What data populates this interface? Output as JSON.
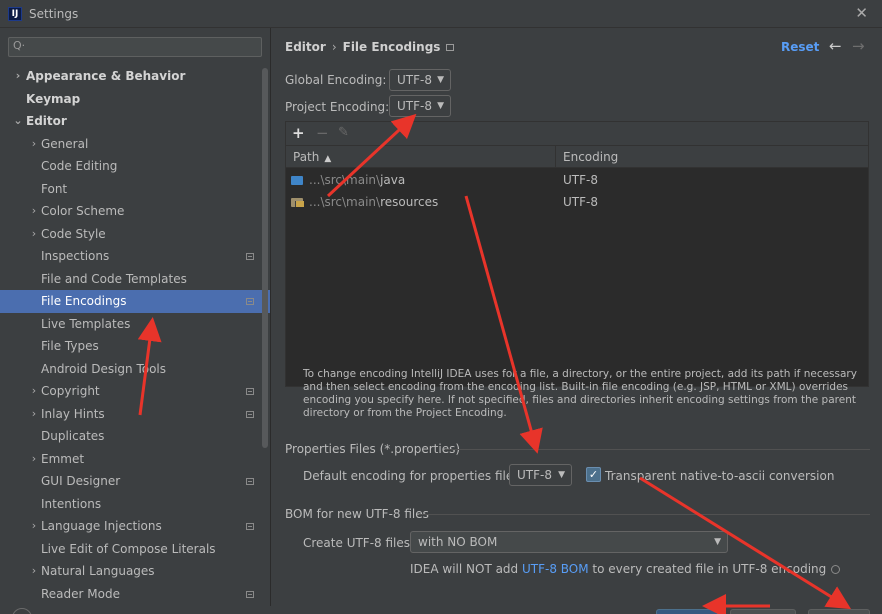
{
  "window": {
    "title": "Settings",
    "app_icon": "intellij-logo-icon",
    "app_icon_text": "IJ",
    "close_glyph": "✕"
  },
  "search": {
    "placeholder": "",
    "icon": "search-icon",
    "glyph": "Q·"
  },
  "sidebar": {
    "items": [
      {
        "label": "Appearance & Behavior",
        "level": 0,
        "expander": "›",
        "bold": true,
        "project_icon": false,
        "selected": false
      },
      {
        "label": "Keymap",
        "level": 0,
        "expander": "",
        "bold": true,
        "project_icon": false,
        "selected": false
      },
      {
        "label": "Editor",
        "level": 0,
        "expander": "⌄",
        "bold": true,
        "project_icon": false,
        "selected": false
      },
      {
        "label": "General",
        "level": 1,
        "expander": "›",
        "bold": false,
        "project_icon": false,
        "selected": false
      },
      {
        "label": "Code Editing",
        "level": 1,
        "expander": "",
        "bold": false,
        "project_icon": false,
        "selected": false
      },
      {
        "label": "Font",
        "level": 1,
        "expander": "",
        "bold": false,
        "project_icon": false,
        "selected": false
      },
      {
        "label": "Color Scheme",
        "level": 1,
        "expander": "›",
        "bold": false,
        "project_icon": false,
        "selected": false
      },
      {
        "label": "Code Style",
        "level": 1,
        "expander": "›",
        "bold": false,
        "project_icon": false,
        "selected": false
      },
      {
        "label": "Inspections",
        "level": 1,
        "expander": "",
        "bold": false,
        "project_icon": true,
        "selected": false
      },
      {
        "label": "File and Code Templates",
        "level": 1,
        "expander": "",
        "bold": false,
        "project_icon": false,
        "selected": false
      },
      {
        "label": "File Encodings",
        "level": 1,
        "expander": "",
        "bold": false,
        "project_icon": true,
        "selected": true
      },
      {
        "label": "Live Templates",
        "level": 1,
        "expander": "",
        "bold": false,
        "project_icon": false,
        "selected": false
      },
      {
        "label": "File Types",
        "level": 1,
        "expander": "",
        "bold": false,
        "project_icon": false,
        "selected": false
      },
      {
        "label": "Android Design Tools",
        "level": 1,
        "expander": "",
        "bold": false,
        "project_icon": false,
        "selected": false
      },
      {
        "label": "Copyright",
        "level": 1,
        "expander": "›",
        "bold": false,
        "project_icon": true,
        "selected": false
      },
      {
        "label": "Inlay Hints",
        "level": 1,
        "expander": "›",
        "bold": false,
        "project_icon": true,
        "selected": false
      },
      {
        "label": "Duplicates",
        "level": 1,
        "expander": "",
        "bold": false,
        "project_icon": false,
        "selected": false
      },
      {
        "label": "Emmet",
        "level": 1,
        "expander": "›",
        "bold": false,
        "project_icon": false,
        "selected": false
      },
      {
        "label": "GUI Designer",
        "level": 1,
        "expander": "",
        "bold": false,
        "project_icon": true,
        "selected": false
      },
      {
        "label": "Intentions",
        "level": 1,
        "expander": "",
        "bold": false,
        "project_icon": false,
        "selected": false
      },
      {
        "label": "Language Injections",
        "level": 1,
        "expander": "›",
        "bold": false,
        "project_icon": true,
        "selected": false
      },
      {
        "label": "Live Edit of Compose Literals",
        "level": 1,
        "expander": "",
        "bold": false,
        "project_icon": false,
        "selected": false
      },
      {
        "label": "Natural Languages",
        "level": 1,
        "expander": "›",
        "bold": false,
        "project_icon": false,
        "selected": false
      },
      {
        "label": "Reader Mode",
        "level": 1,
        "expander": "",
        "bold": false,
        "project_icon": true,
        "selected": false
      }
    ]
  },
  "header": {
    "breadcrumb_parent": "Editor",
    "breadcrumb_sep": "›",
    "breadcrumb_current": "File Encodings",
    "reset_label": "Reset",
    "back_glyph": "←",
    "forward_glyph": "→"
  },
  "encoding": {
    "global_label": "Global Encoding:",
    "global_value": "UTF-8",
    "project_label": "Project Encoding:",
    "project_value": "UTF-8",
    "dropdown_glyph": "▼"
  },
  "table": {
    "toolbar": {
      "add_glyph": "+",
      "remove_glyph": "−",
      "edit_glyph": "✎"
    },
    "columns": {
      "path": "Path",
      "encoding": "Encoding",
      "sort_glyph": "▲"
    },
    "rows": [
      {
        "prefix": "...\\src\\main\\",
        "name": "java",
        "encoding": "UTF-8",
        "icon": "source-folder-icon"
      },
      {
        "prefix": "...\\src\\main\\",
        "name": "resources",
        "encoding": "UTF-8",
        "icon": "resources-folder-icon"
      }
    ]
  },
  "help_text": "To change encoding IntelliJ IDEA uses for a file, a directory, or the entire project, add its path if necessary and then select encoding from the encoding list. Built-in file encoding (e.g. JSP, HTML or XML) overrides encoding you specify here. If not specified, files and directories inherit encoding settings from the parent directory or from the Project Encoding.",
  "properties": {
    "section_title": "Properties Files (*.properties)",
    "default_label": "Default encoding for properties files:",
    "default_value": "UTF-8",
    "transparent_label": "Transparent native-to-ascii conversion",
    "transparent_checked": true,
    "check_glyph": "✓"
  },
  "bom": {
    "section_title": "BOM for new UTF-8 files",
    "create_label": "Create UTF-8 files:",
    "create_value": "with NO BOM",
    "hint_before": "IDEA will NOT add ",
    "hint_link": "UTF-8 BOM",
    "hint_after": " to every created file in UTF-8 encoding"
  },
  "colors": {
    "selection": "#4b6eaf",
    "link": "#589df6",
    "annotation_arrow": "#e8342a"
  }
}
